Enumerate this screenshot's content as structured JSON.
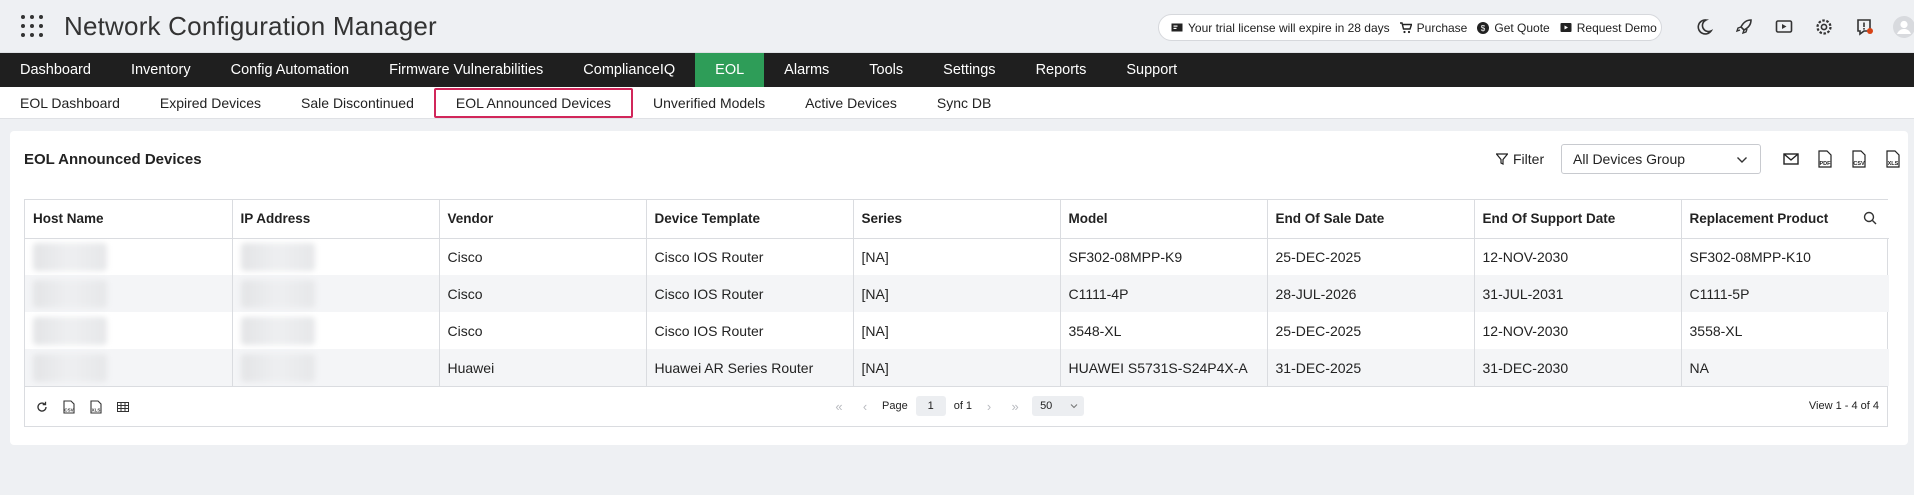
{
  "app": {
    "title": "Network Configuration Manager"
  },
  "trial": {
    "message": "Your trial license will expire in 28 days",
    "purchase": "Purchase",
    "get_quote": "Get Quote",
    "request_demo": "Request Demo"
  },
  "header_icons": [
    "moon-icon",
    "rocket-icon",
    "video-icon",
    "gear-icon",
    "alert-icon",
    "user-avatar-icon"
  ],
  "mainnav": [
    {
      "label": "Dashboard"
    },
    {
      "label": "Inventory"
    },
    {
      "label": "Config Automation"
    },
    {
      "label": "Firmware Vulnerabilities"
    },
    {
      "label": "ComplianceIQ"
    },
    {
      "label": "EOL"
    },
    {
      "label": "Alarms"
    },
    {
      "label": "Tools"
    },
    {
      "label": "Settings"
    },
    {
      "label": "Reports"
    },
    {
      "label": "Support"
    }
  ],
  "mainnav_active": "EOL",
  "subnav": [
    {
      "label": "EOL Dashboard"
    },
    {
      "label": "Expired Devices"
    },
    {
      "label": "Sale Discontinued"
    },
    {
      "label": "EOL Announced Devices"
    },
    {
      "label": "Unverified Models"
    },
    {
      "label": "Active Devices"
    },
    {
      "label": "Sync DB"
    }
  ],
  "subnav_active": "EOL Announced Devices",
  "panel": {
    "title": "EOL Announced Devices",
    "filter_label": "Filter",
    "group_selected": "All Devices Group",
    "export_labels": [
      "PDF",
      "CSV",
      "XLS"
    ]
  },
  "table": {
    "columns": [
      "Host Name",
      "IP Address",
      "Vendor",
      "Device Template",
      "Series",
      "Model",
      "End Of Sale Date",
      "End Of Support Date",
      "Replacement Product"
    ],
    "rows": [
      [
        "",
        "",
        "Cisco",
        "Cisco IOS Router",
        "[NA]",
        "SF302-08MPP-K9",
        "25-DEC-2025",
        "12-NOV-2030",
        "SF302-08MPP-K10"
      ],
      [
        "",
        "",
        "Cisco",
        "Cisco IOS Router",
        "[NA]",
        "C1111-4P",
        "28-JUL-2026",
        "31-JUL-2031",
        "C1111-5P"
      ],
      [
        "",
        "",
        "Cisco",
        "Cisco IOS Router",
        "[NA]",
        "3548-XL",
        "25-DEC-2025",
        "12-NOV-2030",
        "3558-XL"
      ],
      [
        "",
        "",
        "Huawei",
        "Huawei AR Series Router",
        "[NA]",
        "HUAWEI S5731S-S24P4X-A",
        "31-DEC-2025",
        "31-DEC-2030",
        "NA"
      ]
    ]
  },
  "pager": {
    "page_label": "Page",
    "page_value": "1",
    "of_label": "of 1",
    "page_size": "50",
    "view_count": "View 1 - 4 of 4",
    "footer_icon_labels": [
      "CSV",
      "XLS"
    ]
  },
  "colors": {
    "nav_bg": "#1f1f1f",
    "nav_active": "#2e9d58",
    "highlight": "#d1265a"
  }
}
